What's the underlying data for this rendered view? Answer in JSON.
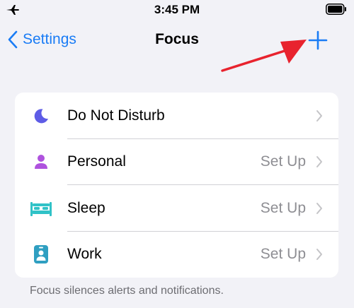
{
  "status_bar": {
    "time": "3:45 PM"
  },
  "nav": {
    "back_label": "Settings",
    "title": "Focus"
  },
  "colors": {
    "accent": "#1a7cf5",
    "annotation_arrow": "#e8232e",
    "do_not_disturb": "#5e5ce6",
    "personal": "#af52de",
    "sleep": "#30c2c7",
    "work": "#2f9fc1"
  },
  "focus_modes": [
    {
      "label": "Do Not Disturb",
      "status": "",
      "icon": "moon-icon"
    },
    {
      "label": "Personal",
      "status": "Set Up",
      "icon": "person-icon"
    },
    {
      "label": "Sleep",
      "status": "Set Up",
      "icon": "bed-icon"
    },
    {
      "label": "Work",
      "status": "Set Up",
      "icon": "id-badge-icon"
    }
  ],
  "footer": {
    "note": "Focus silences alerts and notifications."
  }
}
